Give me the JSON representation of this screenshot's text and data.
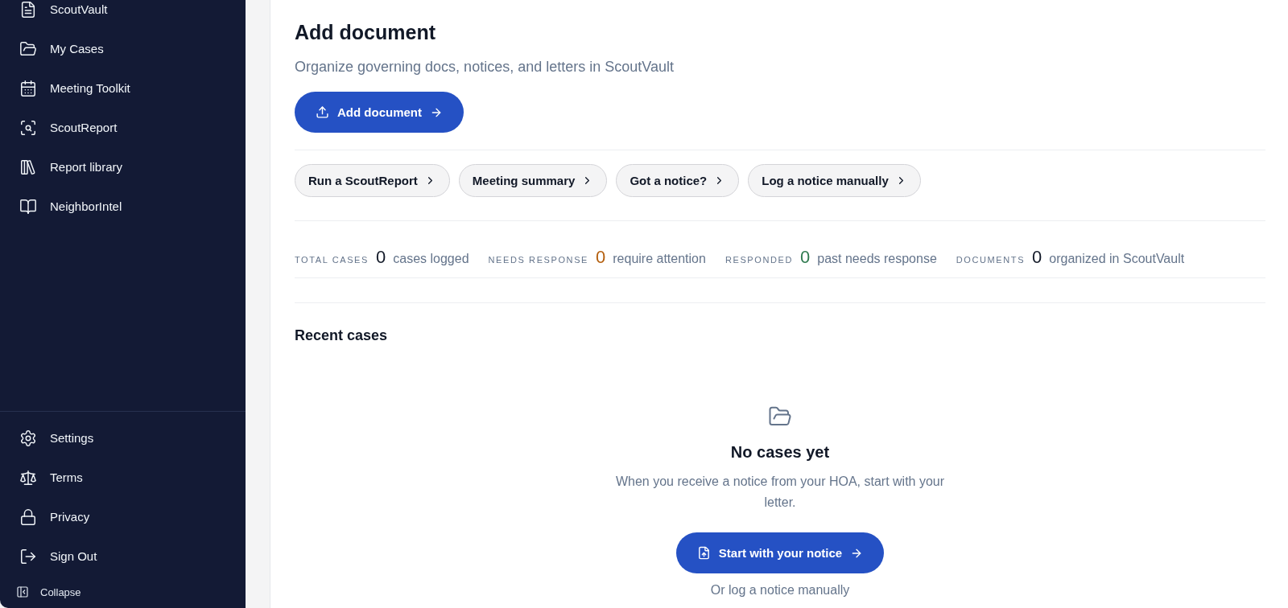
{
  "sidebar": {
    "nav_items": [
      "ScoutVault",
      "My Cases",
      "Meeting Toolkit",
      "ScoutReport",
      "Report library",
      "NeighborIntel"
    ],
    "footer_items": [
      "Settings",
      "Terms",
      "Privacy",
      "Sign Out"
    ],
    "collapse": "Collapse"
  },
  "header": {
    "title": "Add document",
    "subtitle": "Organize governing docs, notices, and letters in ScoutVault",
    "primary_button": "Add document"
  },
  "quick_actions": [
    "Run a ScoutReport",
    "Meeting summary",
    "Got a notice?",
    "Log a notice manually"
  ],
  "stats": [
    {
      "label": "TOTAL CASES",
      "value": "0",
      "caption": "cases logged",
      "color": "#111827"
    },
    {
      "label": "NEEDS RESPONSE",
      "value": "0",
      "caption": "require attention",
      "color": "#b45f0e"
    },
    {
      "label": "RESPONDED",
      "value": "0",
      "caption": "past needs response",
      "color": "#2f7a4f"
    },
    {
      "label": "DOCUMENTS",
      "value": "0",
      "caption": "organized in ScoutVault",
      "color": "#111827"
    }
  ],
  "recent_cases": {
    "title": "Recent cases",
    "empty_title": "No cases yet",
    "empty_text": "When you receive a notice from your HOA, start with your letter.",
    "button": "Start with your notice",
    "link": "Or log a notice manually"
  }
}
